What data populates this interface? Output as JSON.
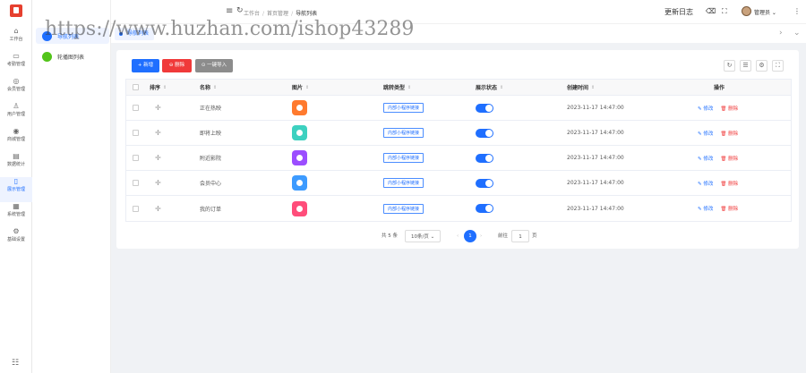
{
  "rail": {
    "items": [
      {
        "icon": "⌂",
        "label": "工作台"
      },
      {
        "icon": "▭",
        "label": "考勤管理"
      },
      {
        "icon": "◎",
        "label": "会员管理"
      },
      {
        "icon": "♙",
        "label": "用户管理"
      },
      {
        "icon": "◉",
        "label": "商城管理"
      },
      {
        "icon": "▤",
        "label": "数据统计"
      },
      {
        "icon": "▯",
        "label": "展示管理"
      },
      {
        "icon": "▦",
        "label": "系统管理"
      },
      {
        "icon": "⚙",
        "label": "基础设置"
      }
    ],
    "footer_icon": "☷"
  },
  "subnav": {
    "items": [
      {
        "label": "导航列表",
        "color": "#1f6fff"
      },
      {
        "label": "轮播图列表",
        "color": "#52c41a"
      }
    ]
  },
  "topbar": {
    "breadcrumbs": [
      "工作台",
      "首页管理",
      "导航列表"
    ],
    "right_label": "更新日志",
    "user_name": "管理员"
  },
  "tabs": {
    "active": "导航列表"
  },
  "toolbar": {
    "add": "+ 新增",
    "delete": "⊖ 删除",
    "export": "⊙ 一键导入",
    "tools": [
      "↻",
      "☰",
      "⚙",
      "⛶"
    ]
  },
  "table": {
    "headers": [
      "排序",
      "名称",
      "图片",
      "跳转类型",
      "展示状态",
      "创建时间",
      "操作"
    ],
    "rows": [
      {
        "name": "正在热映",
        "color": "#ff7a2e",
        "jump": "内部小程序链接",
        "time": "2023-11-17 14:47:00"
      },
      {
        "name": "即将上映",
        "color": "#3dd1c0",
        "jump": "内部小程序链接",
        "time": "2023-11-17 14:47:00"
      },
      {
        "name": "附近影院",
        "color": "#9b4dff",
        "jump": "内部小程序链接",
        "time": "2023-11-17 14:47:00"
      },
      {
        "name": "会员中心",
        "color": "#3d9bff",
        "jump": "内部小程序链接",
        "time": "2023-11-17 14:47:00"
      },
      {
        "name": "我的订单",
        "color": "#ff4d7a",
        "jump": "内部小程序链接",
        "time": "2023-11-17 14:47:00"
      }
    ],
    "edit_label": "✎ 修改",
    "delete_label": "🗑 删除"
  },
  "pager": {
    "total": "共 5 条",
    "page_size": "10条/页",
    "current": "1",
    "goto_label": "前往",
    "goto_value": "1",
    "page_unit": "页"
  },
  "watermark": "https://www.huzhan.com/ishop43289"
}
